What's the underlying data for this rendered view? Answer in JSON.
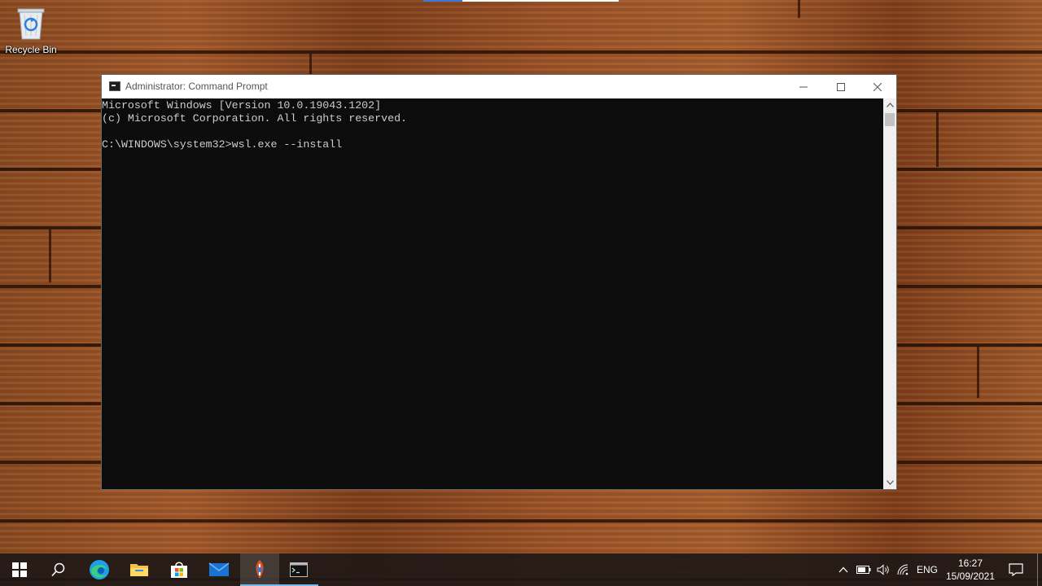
{
  "desktop": {
    "recycle_bin_label": "Recycle Bin"
  },
  "window": {
    "title": "Administrator: Command Prompt",
    "console_lines": [
      "Microsoft Windows [Version 10.0.19043.1202]",
      "(c) Microsoft Corporation. All rights reserved.",
      "",
      "C:\\WINDOWS\\system32>wsl.exe --install"
    ]
  },
  "taskbar": {
    "apps": [
      {
        "name": "start",
        "icon": "windows-logo-icon"
      },
      {
        "name": "search",
        "icon": "search-icon"
      },
      {
        "name": "edge",
        "icon": "edge-icon"
      },
      {
        "name": "file-explorer",
        "icon": "folder-icon"
      },
      {
        "name": "store",
        "icon": "store-icon"
      },
      {
        "name": "mail",
        "icon": "mail-icon"
      },
      {
        "name": "app-active",
        "icon": "app-icon"
      },
      {
        "name": "command-prompt",
        "icon": "cmd-icon"
      }
    ],
    "tray": {
      "language": "ENG",
      "time": "16:27",
      "date": "15/09/2021"
    }
  },
  "colors": {
    "console_bg": "#0c0c0c",
    "console_fg": "#cccccc",
    "accent": "#76b9ed"
  }
}
